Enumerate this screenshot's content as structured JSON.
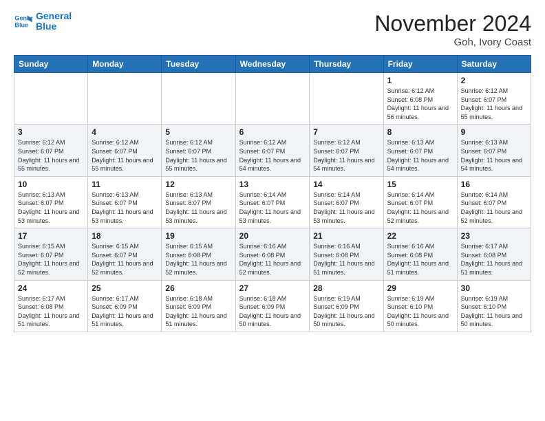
{
  "header": {
    "logo_line1": "General",
    "logo_line2": "Blue",
    "month_title": "November 2024",
    "location": "Goh, Ivory Coast"
  },
  "weekdays": [
    "Sunday",
    "Monday",
    "Tuesday",
    "Wednesday",
    "Thursday",
    "Friday",
    "Saturday"
  ],
  "weeks": [
    [
      {
        "day": "",
        "info": ""
      },
      {
        "day": "",
        "info": ""
      },
      {
        "day": "",
        "info": ""
      },
      {
        "day": "",
        "info": ""
      },
      {
        "day": "",
        "info": ""
      },
      {
        "day": "1",
        "info": "Sunrise: 6:12 AM\nSunset: 6:08 PM\nDaylight: 11 hours\nand 56 minutes."
      },
      {
        "day": "2",
        "info": "Sunrise: 6:12 AM\nSunset: 6:07 PM\nDaylight: 11 hours\nand 55 minutes."
      }
    ],
    [
      {
        "day": "3",
        "info": "Sunrise: 6:12 AM\nSunset: 6:07 PM\nDaylight: 11 hours\nand 55 minutes."
      },
      {
        "day": "4",
        "info": "Sunrise: 6:12 AM\nSunset: 6:07 PM\nDaylight: 11 hours\nand 55 minutes."
      },
      {
        "day": "5",
        "info": "Sunrise: 6:12 AM\nSunset: 6:07 PM\nDaylight: 11 hours\nand 55 minutes."
      },
      {
        "day": "6",
        "info": "Sunrise: 6:12 AM\nSunset: 6:07 PM\nDaylight: 11 hours\nand 54 minutes."
      },
      {
        "day": "7",
        "info": "Sunrise: 6:12 AM\nSunset: 6:07 PM\nDaylight: 11 hours\nand 54 minutes."
      },
      {
        "day": "8",
        "info": "Sunrise: 6:13 AM\nSunset: 6:07 PM\nDaylight: 11 hours\nand 54 minutes."
      },
      {
        "day": "9",
        "info": "Sunrise: 6:13 AM\nSunset: 6:07 PM\nDaylight: 11 hours\nand 54 minutes."
      }
    ],
    [
      {
        "day": "10",
        "info": "Sunrise: 6:13 AM\nSunset: 6:07 PM\nDaylight: 11 hours\nand 53 minutes."
      },
      {
        "day": "11",
        "info": "Sunrise: 6:13 AM\nSunset: 6:07 PM\nDaylight: 11 hours\nand 53 minutes."
      },
      {
        "day": "12",
        "info": "Sunrise: 6:13 AM\nSunset: 6:07 PM\nDaylight: 11 hours\nand 53 minutes."
      },
      {
        "day": "13",
        "info": "Sunrise: 6:14 AM\nSunset: 6:07 PM\nDaylight: 11 hours\nand 53 minutes."
      },
      {
        "day": "14",
        "info": "Sunrise: 6:14 AM\nSunset: 6:07 PM\nDaylight: 11 hours\nand 53 minutes."
      },
      {
        "day": "15",
        "info": "Sunrise: 6:14 AM\nSunset: 6:07 PM\nDaylight: 11 hours\nand 52 minutes."
      },
      {
        "day": "16",
        "info": "Sunrise: 6:14 AM\nSunset: 6:07 PM\nDaylight: 11 hours\nand 52 minutes."
      }
    ],
    [
      {
        "day": "17",
        "info": "Sunrise: 6:15 AM\nSunset: 6:07 PM\nDaylight: 11 hours\nand 52 minutes."
      },
      {
        "day": "18",
        "info": "Sunrise: 6:15 AM\nSunset: 6:07 PM\nDaylight: 11 hours\nand 52 minutes."
      },
      {
        "day": "19",
        "info": "Sunrise: 6:15 AM\nSunset: 6:08 PM\nDaylight: 11 hours\nand 52 minutes."
      },
      {
        "day": "20",
        "info": "Sunrise: 6:16 AM\nSunset: 6:08 PM\nDaylight: 11 hours\nand 52 minutes."
      },
      {
        "day": "21",
        "info": "Sunrise: 6:16 AM\nSunset: 6:08 PM\nDaylight: 11 hours\nand 51 minutes."
      },
      {
        "day": "22",
        "info": "Sunrise: 6:16 AM\nSunset: 6:08 PM\nDaylight: 11 hours\nand 51 minutes."
      },
      {
        "day": "23",
        "info": "Sunrise: 6:17 AM\nSunset: 6:08 PM\nDaylight: 11 hours\nand 51 minutes."
      }
    ],
    [
      {
        "day": "24",
        "info": "Sunrise: 6:17 AM\nSunset: 6:08 PM\nDaylight: 11 hours\nand 51 minutes."
      },
      {
        "day": "25",
        "info": "Sunrise: 6:17 AM\nSunset: 6:09 PM\nDaylight: 11 hours\nand 51 minutes."
      },
      {
        "day": "26",
        "info": "Sunrise: 6:18 AM\nSunset: 6:09 PM\nDaylight: 11 hours\nand 51 minutes."
      },
      {
        "day": "27",
        "info": "Sunrise: 6:18 AM\nSunset: 6:09 PM\nDaylight: 11 hours\nand 50 minutes."
      },
      {
        "day": "28",
        "info": "Sunrise: 6:19 AM\nSunset: 6:09 PM\nDaylight: 11 hours\nand 50 minutes."
      },
      {
        "day": "29",
        "info": "Sunrise: 6:19 AM\nSunset: 6:10 PM\nDaylight: 11 hours\nand 50 minutes."
      },
      {
        "day": "30",
        "info": "Sunrise: 6:19 AM\nSunset: 6:10 PM\nDaylight: 11 hours\nand 50 minutes."
      }
    ]
  ]
}
